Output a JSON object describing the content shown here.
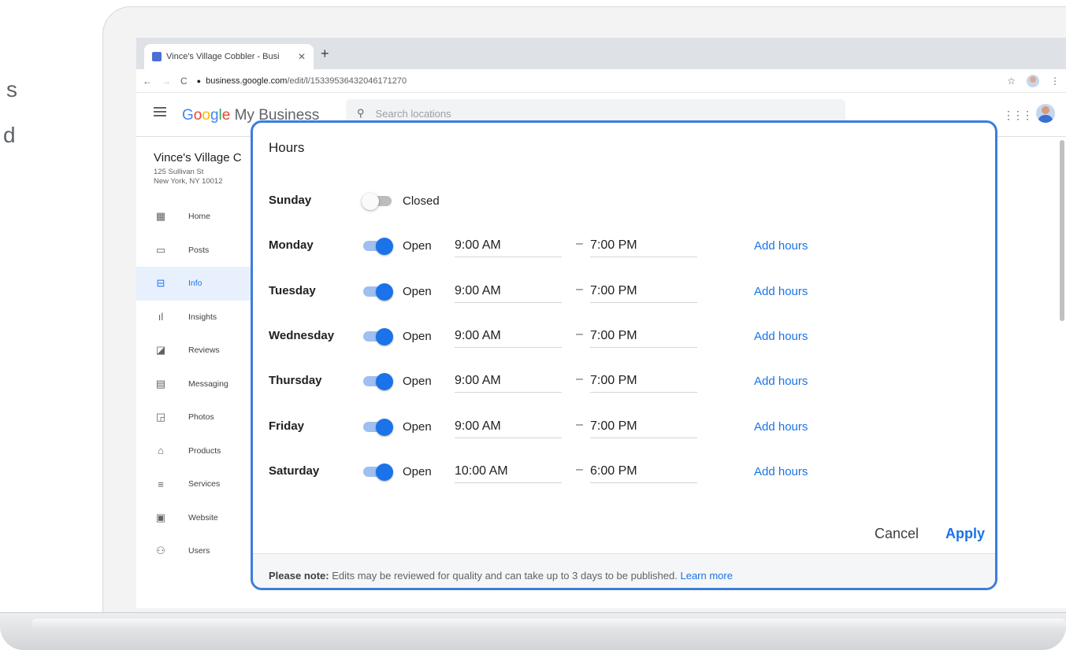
{
  "browser": {
    "tab_title": "Vince's Village Cobbler - Busi",
    "tab_close": "✕",
    "new_tab": "+",
    "url_host": "business.google.com",
    "url_path": "/edit/l/15339536432046171270"
  },
  "app": {
    "brand_suffix": "My Business",
    "search_placeholder": "Search locations"
  },
  "business": {
    "name": "Vince's Village C",
    "address_line1": "125 Sullivan St",
    "address_line2": "New York, NY 10012"
  },
  "sidebar": {
    "items": [
      {
        "label": "Home",
        "icon": "dashboard-icon"
      },
      {
        "label": "Posts",
        "icon": "posts-icon"
      },
      {
        "label": "Info",
        "icon": "storefront-icon",
        "active": true
      },
      {
        "label": "Insights",
        "icon": "bar-chart-icon"
      },
      {
        "label": "Reviews",
        "icon": "reviews-icon"
      },
      {
        "label": "Messaging",
        "icon": "message-icon"
      },
      {
        "label": "Photos",
        "icon": "photos-icon"
      },
      {
        "label": "Products",
        "icon": "basket-icon"
      },
      {
        "label": "Services",
        "icon": "list-icon"
      },
      {
        "label": "Website",
        "icon": "website-icon"
      },
      {
        "label": "Users",
        "icon": "add-user-icon"
      }
    ]
  },
  "dialog": {
    "title": "Hours",
    "days": [
      {
        "day": "Sunday",
        "open": false,
        "status": "Closed"
      },
      {
        "day": "Monday",
        "open": true,
        "status": "Open",
        "opens": "9:00 AM",
        "closes": "7:00 PM",
        "add": "Add hours"
      },
      {
        "day": "Tuesday",
        "open": true,
        "status": "Open",
        "opens": "9:00 AM",
        "closes": "7:00 PM",
        "add": "Add hours"
      },
      {
        "day": "Wednesday",
        "open": true,
        "status": "Open",
        "opens": "9:00 AM",
        "closes": "7:00 PM",
        "add": "Add hours"
      },
      {
        "day": "Thursday",
        "open": true,
        "status": "Open",
        "opens": "9:00 AM",
        "closes": "7:00 PM",
        "add": "Add hours"
      },
      {
        "day": "Friday",
        "open": true,
        "status": "Open",
        "opens": "9:00 AM",
        "closes": "7:00 PM",
        "add": "Add hours"
      },
      {
        "day": "Saturday",
        "open": true,
        "status": "Open",
        "opens": "10:00 AM",
        "closes": "6:00 PM",
        "add": "Add hours"
      }
    ],
    "cancel_label": "Cancel",
    "apply_label": "Apply",
    "note_bold": "Please note:",
    "note_text": " Edits may be reviewed for quality and can take up to 3 days to be published. ",
    "learn_more": "Learn more"
  },
  "background": {
    "fragment_1": "s",
    "fragment_2": "d"
  },
  "colors": {
    "accent": "#1a73e8",
    "dialog_border": "#3b7ddd"
  }
}
